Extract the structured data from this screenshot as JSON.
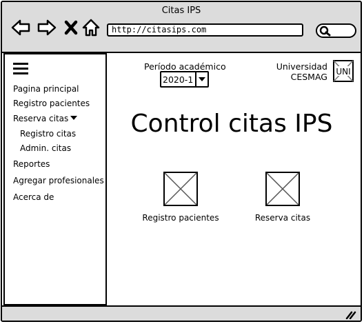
{
  "window": {
    "title": "Citas IPS",
    "url": "http://citasips.com",
    "search_placeholder": ""
  },
  "sidebar": {
    "items": [
      {
        "label": "Pagina principal"
      },
      {
        "label": "Registro pacientes"
      },
      {
        "label": "Reserva citas",
        "expanded": true
      },
      {
        "label": "Registro citas",
        "sub": true
      },
      {
        "label": "Admin. citas",
        "sub": true
      },
      {
        "label": "Reportes"
      },
      {
        "label": "Agregar profesionales"
      },
      {
        "label": "Acerca de"
      }
    ]
  },
  "header": {
    "period_label": "Período académico",
    "period_value": "2020-1",
    "university_line1": "Universidad",
    "university_line2": "CESMAG",
    "logo_text": "UNI"
  },
  "main": {
    "title": "Control citas IPS",
    "shortcuts": [
      {
        "label": "Registro pacientes"
      },
      {
        "label": "Reserva citas"
      }
    ]
  },
  "icons": {
    "back": "arrow-left-icon",
    "forward": "arrow-right-icon",
    "stop": "close-icon",
    "home": "home-icon",
    "search": "search-icon",
    "menu": "hamburger-icon",
    "resize": "resize-grip-icon"
  }
}
